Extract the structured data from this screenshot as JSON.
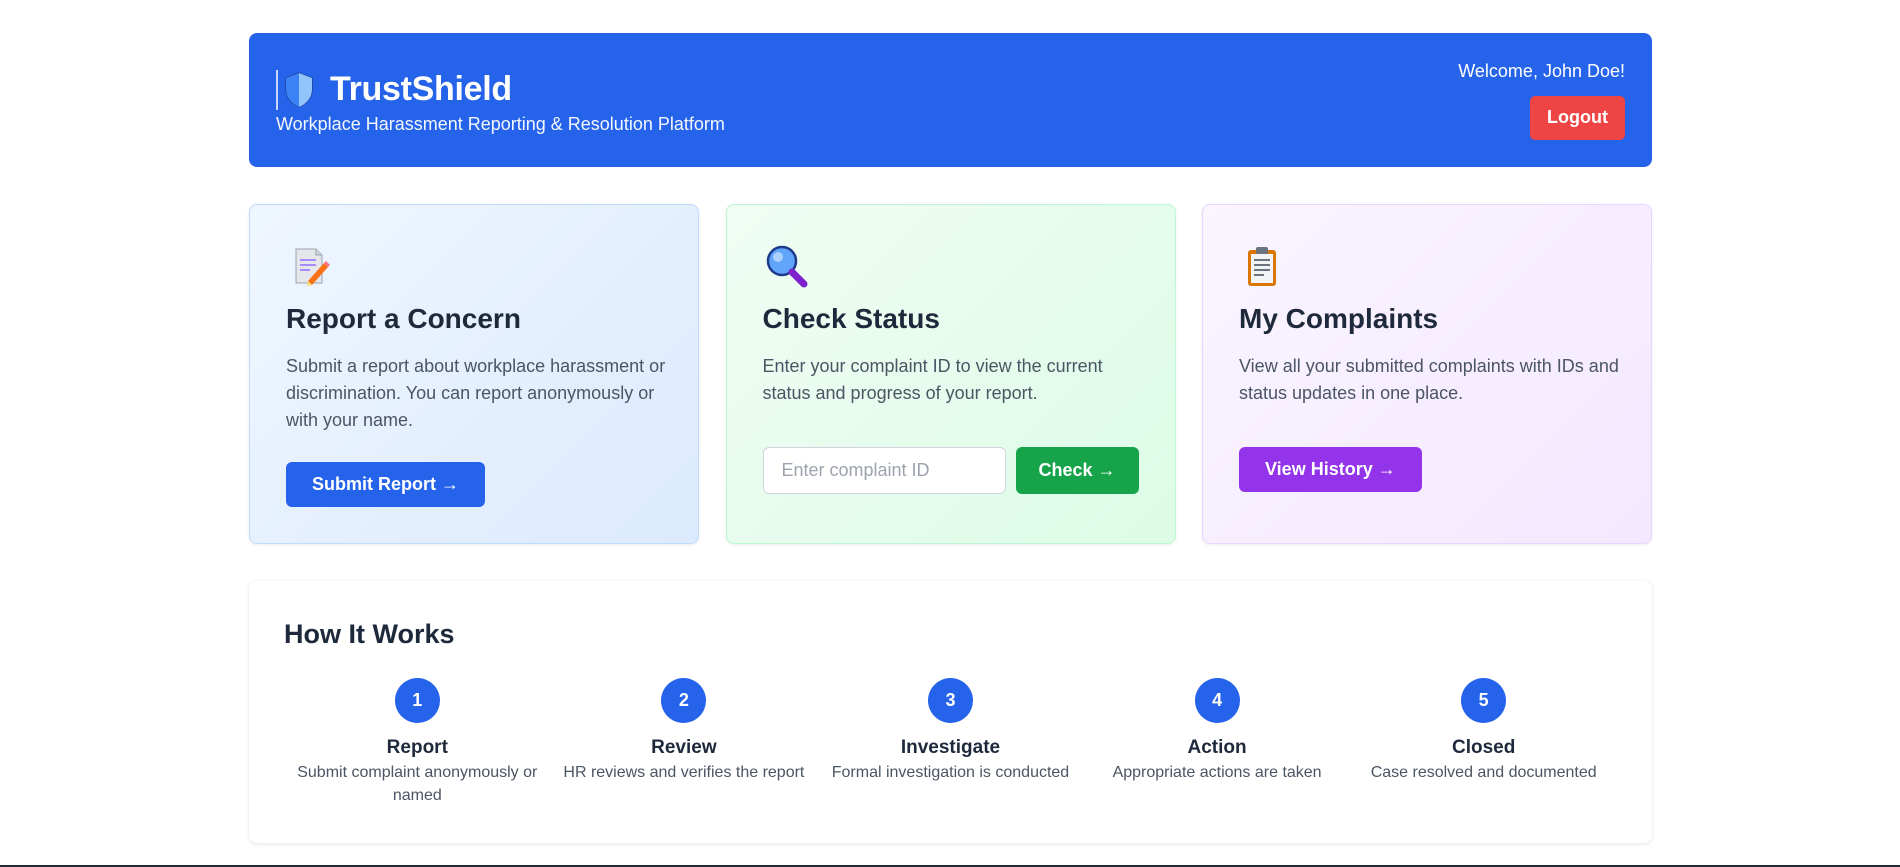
{
  "header": {
    "title": "TrustShield",
    "subtitle": "Workplace Harassment Reporting & Resolution Platform",
    "welcome": "Welcome, John Doe!",
    "logout_label": "Logout",
    "logo_icon": "shield-icon"
  },
  "cards": {
    "report": {
      "icon": "memo-icon",
      "title": "Report a Concern",
      "description": "Submit a report about workplace harassment or discrimination. You can report anonymously or with your name.",
      "button_label": "Submit Report →"
    },
    "status": {
      "icon": "magnifier-icon",
      "title": "Check Status",
      "description": "Enter your complaint ID to view the current status and progress of your report.",
      "input_placeholder": "Enter complaint ID",
      "input_value": "",
      "button_label": "Check →"
    },
    "complaints": {
      "icon": "clipboard-icon",
      "title": "My Complaints",
      "description": "View all your submitted complaints with IDs and status updates in one place.",
      "button_label": "View History →"
    }
  },
  "how": {
    "title": "How It Works",
    "steps": [
      {
        "number": "1",
        "title": "Report",
        "description": "Submit complaint anonymously or named"
      },
      {
        "number": "2",
        "title": "Review",
        "description": "HR reviews and verifies the report"
      },
      {
        "number": "3",
        "title": "Investigate",
        "description": "Formal investigation is conducted"
      },
      {
        "number": "4",
        "title": "Action",
        "description": "Appropriate actions are taken"
      },
      {
        "number": "5",
        "title": "Closed",
        "description": "Case resolved and documented"
      }
    ]
  },
  "colors": {
    "primary": "#2563eb",
    "danger": "#ef4444",
    "success": "#16a34a",
    "purple": "#9333ea"
  }
}
